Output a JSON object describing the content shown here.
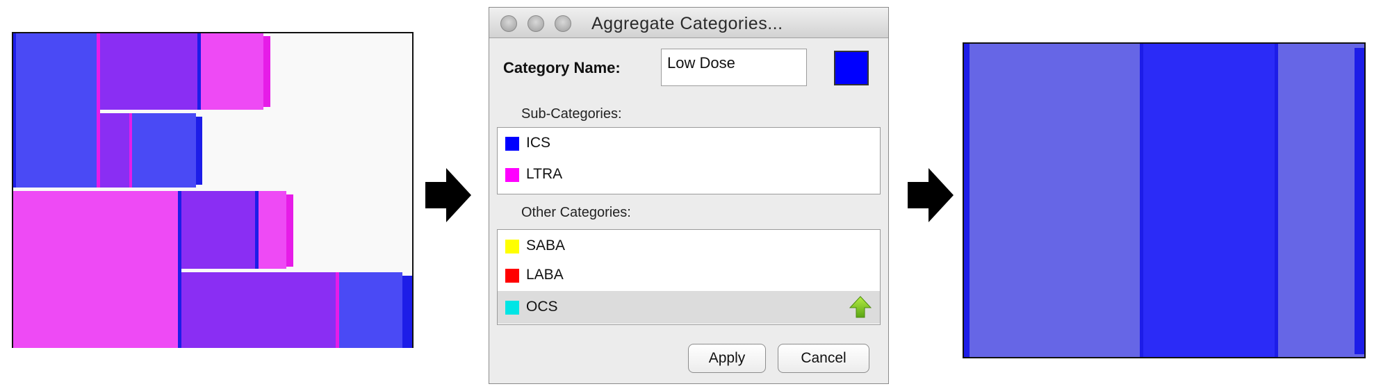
{
  "dialog": {
    "title": "Aggregate Categories...",
    "category_name_label": "Category Name:",
    "category_name_value": "Low Dose",
    "category_color": "#0000ff",
    "sub_categories_label": "Sub-Categories:",
    "sub_categories": [
      {
        "label": "ICS",
        "color": "#0000ff"
      },
      {
        "label": "LTRA",
        "color": "#ff00ff"
      }
    ],
    "other_categories_label": "Other Categories:",
    "other_categories": [
      {
        "label": "SABA",
        "color": "#ffff00"
      },
      {
        "label": "LABA",
        "color": "#ff0000"
      },
      {
        "label": "OCS",
        "color": "#00e5e5",
        "selected": true
      }
    ],
    "apply_label": "Apply",
    "cancel_label": "Cancel",
    "move_up_icon": "green-up-arrow-icon"
  },
  "colors": {
    "blue_block": "#4a4af5",
    "purple_block": "#8a2ef3",
    "pink_block": "#ee4af5",
    "aggregate_light": "#6666e6",
    "aggregate_dark": "#2b2bf7"
  },
  "arrows": [
    "right-arrow-icon",
    "right-arrow-icon"
  ]
}
